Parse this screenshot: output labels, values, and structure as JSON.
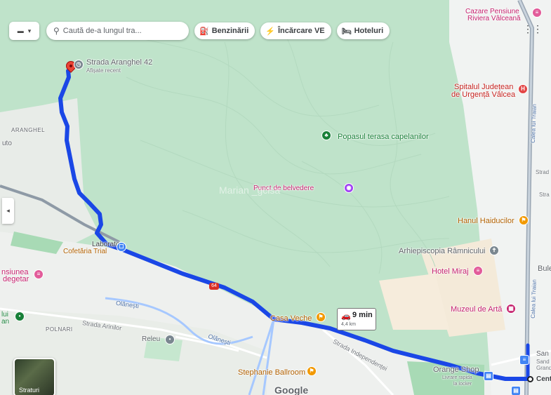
{
  "search": {
    "placeholder": "Caută de-a lungul tra..."
  },
  "chips": [
    {
      "label": "Benzinării",
      "icon": "gas-station-icon"
    },
    {
      "label": "Încărcare VE",
      "icon": "ev-charging-icon"
    },
    {
      "label": "Hoteluri",
      "icon": "hotel-icon"
    }
  ],
  "route": {
    "duration": "9 min",
    "distance": "4,4 km",
    "color": "#1a47e6"
  },
  "origin": {
    "name": "Strada Aranghel 42",
    "note": "Afișate recent"
  },
  "layers": {
    "label": "Straturi"
  },
  "labels": {
    "top_right_1": "Cazare Pensiune",
    "top_right_2": "Riviera Vâlceană",
    "hospital_1": "Spitalul Județean",
    "hospital_2": "de Urgență Vâlcea",
    "popas": "Popasul terasa capelanilor",
    "belvedere": "Punct de belvedere",
    "watermark": "Marian _gcisa",
    "aranghel": "ARANGHEL",
    "auto": "uto",
    "laborator_1": "Laborator",
    "laborator_2": "Cofetăria Trial",
    "pensiune_1": "nsiunea",
    "pensiune_2": "degetar",
    "haiducilor": "Hanul Haiducilor",
    "arhiepiscopia": "Arhiepiscopia Râmnicului",
    "miraj": "Hotel Miraj",
    "muzeu": "Muzeul de Artă",
    "casa_veche": "Casa Veche",
    "olanesti_1": "Olănești",
    "olanesti_2": "Olănești",
    "arinilor": "Strada Arinilor",
    "polnari": "POLNARI",
    "releu": "Releu",
    "lui_1": "lui",
    "lui_2": "an",
    "independentei": "Strada Independenței",
    "stephanie": "Stephanie Ballroom",
    "orange": "Orange Shop",
    "livrare_1": "Livrare rapida",
    "livrare_2": "la locker",
    "google": "Google",
    "calea_traian_1": "Calea lui Traian",
    "calea_traian_2": "Calea lui Traian",
    "strada_1": "Strad",
    "strada_2": "Stra",
    "bule": "Bule",
    "san_1": "San",
    "san_2": "Sand",
    "san_3": "Grand",
    "cent": "Cent",
    "road_badge": "64"
  }
}
